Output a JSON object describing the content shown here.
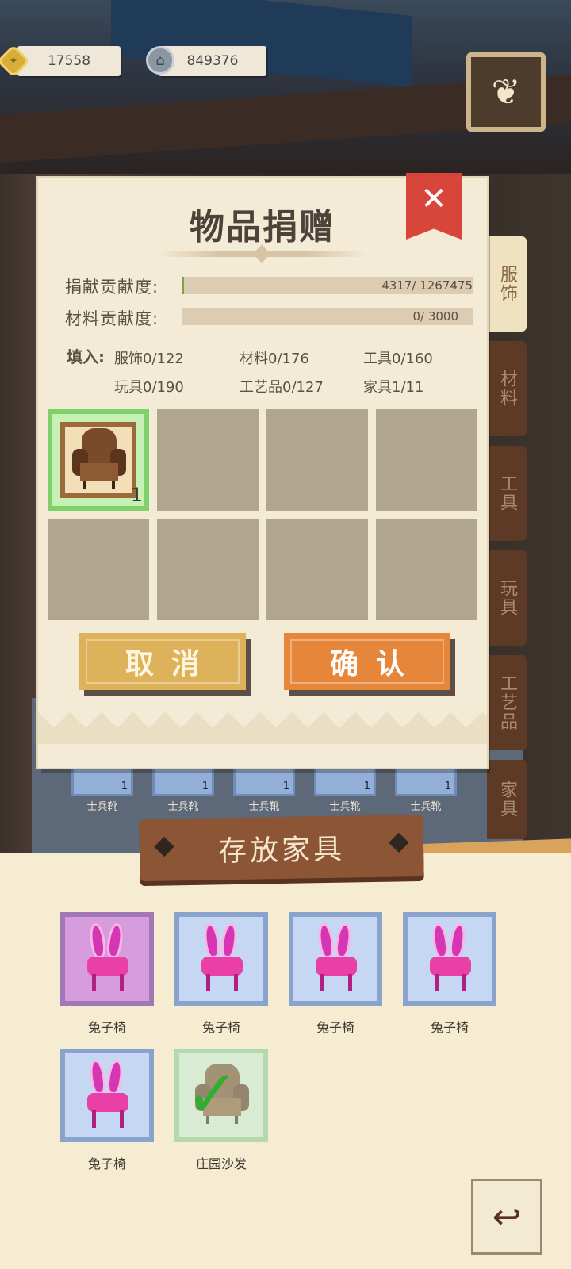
{
  "currency": {
    "gold": "17558",
    "silver": "849376"
  },
  "side_tabs": [
    {
      "label": "服饰",
      "active": true
    },
    {
      "label": "材料",
      "active": false
    },
    {
      "label": "工具",
      "active": false
    },
    {
      "label": "玩具",
      "active": false
    },
    {
      "label": "工艺品",
      "active": false
    },
    {
      "label": "家具",
      "active": false
    }
  ],
  "dialog": {
    "title": "物品捐赠",
    "close_icon": "✕",
    "donation_label": "捐献贡献度:",
    "donation_value": "4317/ 1267475",
    "donation_progress": 0.0034,
    "material_label": "材料贡献度:",
    "material_value": "0/ 3000",
    "material_progress": 0,
    "fill_label": "填入:",
    "fill_items": {
      "clothing": "服饰0/122",
      "material": "材料0/176",
      "tool": "工具0/160",
      "toy": "玩具0/190",
      "craft": "工艺品0/127",
      "furniture": "家具1/11"
    },
    "slot1_count": "1",
    "cancel_label": "取消",
    "confirm_label": "确认"
  },
  "cabinet_row": {
    "items": [
      {
        "label": "士兵靴",
        "count": "1"
      },
      {
        "label": "士兵靴",
        "count": "1"
      },
      {
        "label": "士兵靴",
        "count": "1"
      },
      {
        "label": "士兵靴",
        "count": "1"
      },
      {
        "label": "士兵靴",
        "count": "1"
      }
    ]
  },
  "storage": {
    "title": "存放家具",
    "items": [
      {
        "label": "兔子椅"
      },
      {
        "label": "兔子椅"
      },
      {
        "label": "兔子椅"
      },
      {
        "label": "兔子椅"
      },
      {
        "label": "兔子椅"
      },
      {
        "label": "庄园沙发"
      }
    ]
  },
  "colors": {
    "accent_orange": "#e5863a",
    "accent_gold": "#ddb25a",
    "close_red": "#d8453a",
    "progress_green": "#7fa14a"
  }
}
